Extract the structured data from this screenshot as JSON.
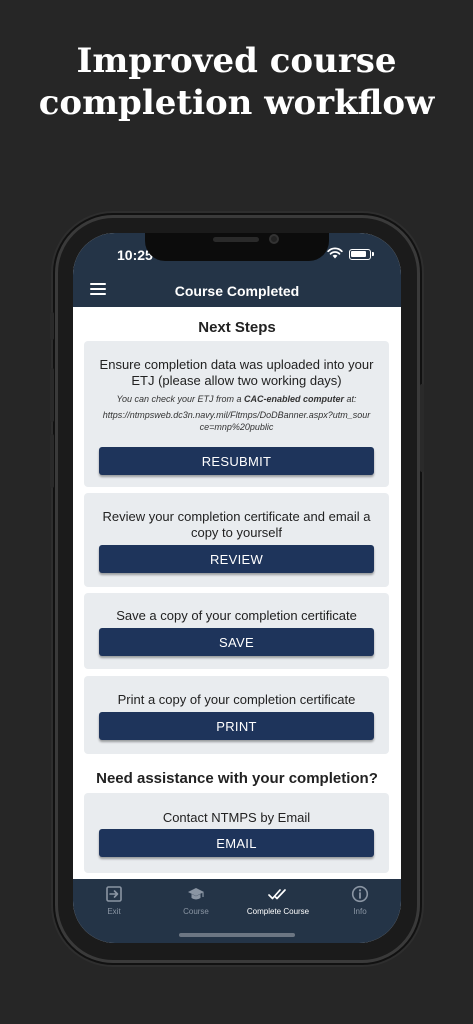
{
  "headline": {
    "line1": "Improved course",
    "line2": "completion workflow"
  },
  "status_bar": {
    "time": "10:25"
  },
  "header": {
    "title": "Course Completed"
  },
  "next_steps": {
    "title": "Next Steps",
    "etj": {
      "text": "Ensure completion data was uploaded into your ETJ (please allow two working days)",
      "note_prefix": "You can check your ETJ from a",
      "note_bold": "CAC-enabled computer",
      "note_suffix": "at:",
      "url": "https://ntmpsweb.dc3n.navy.mil/Fltmps/DoDBanner.aspx?utm_source=mnp%20public",
      "button": "RESUBMIT"
    },
    "review": {
      "text": "Review your completion certificate and email a copy to yourself",
      "button": "REVIEW"
    },
    "save": {
      "text": "Save a copy of your completion certificate",
      "button": "SAVE"
    },
    "print": {
      "text": "Print a copy of your completion certificate",
      "button": "PRINT"
    }
  },
  "assistance": {
    "title": "Need assistance with your completion?",
    "email": {
      "text": "Contact NTMPS by Email",
      "button": "EMAIL"
    }
  },
  "tabs": [
    {
      "label": "Exit",
      "icon": "exit-icon"
    },
    {
      "label": "Course",
      "icon": "graduation-cap-icon"
    },
    {
      "label": "Complete Course",
      "icon": "double-check-icon"
    },
    {
      "label": "Info",
      "icon": "info-icon"
    }
  ],
  "colors": {
    "header": "#243447",
    "button": "#1e345b",
    "card": "#e9ecef",
    "background": "#262626"
  }
}
